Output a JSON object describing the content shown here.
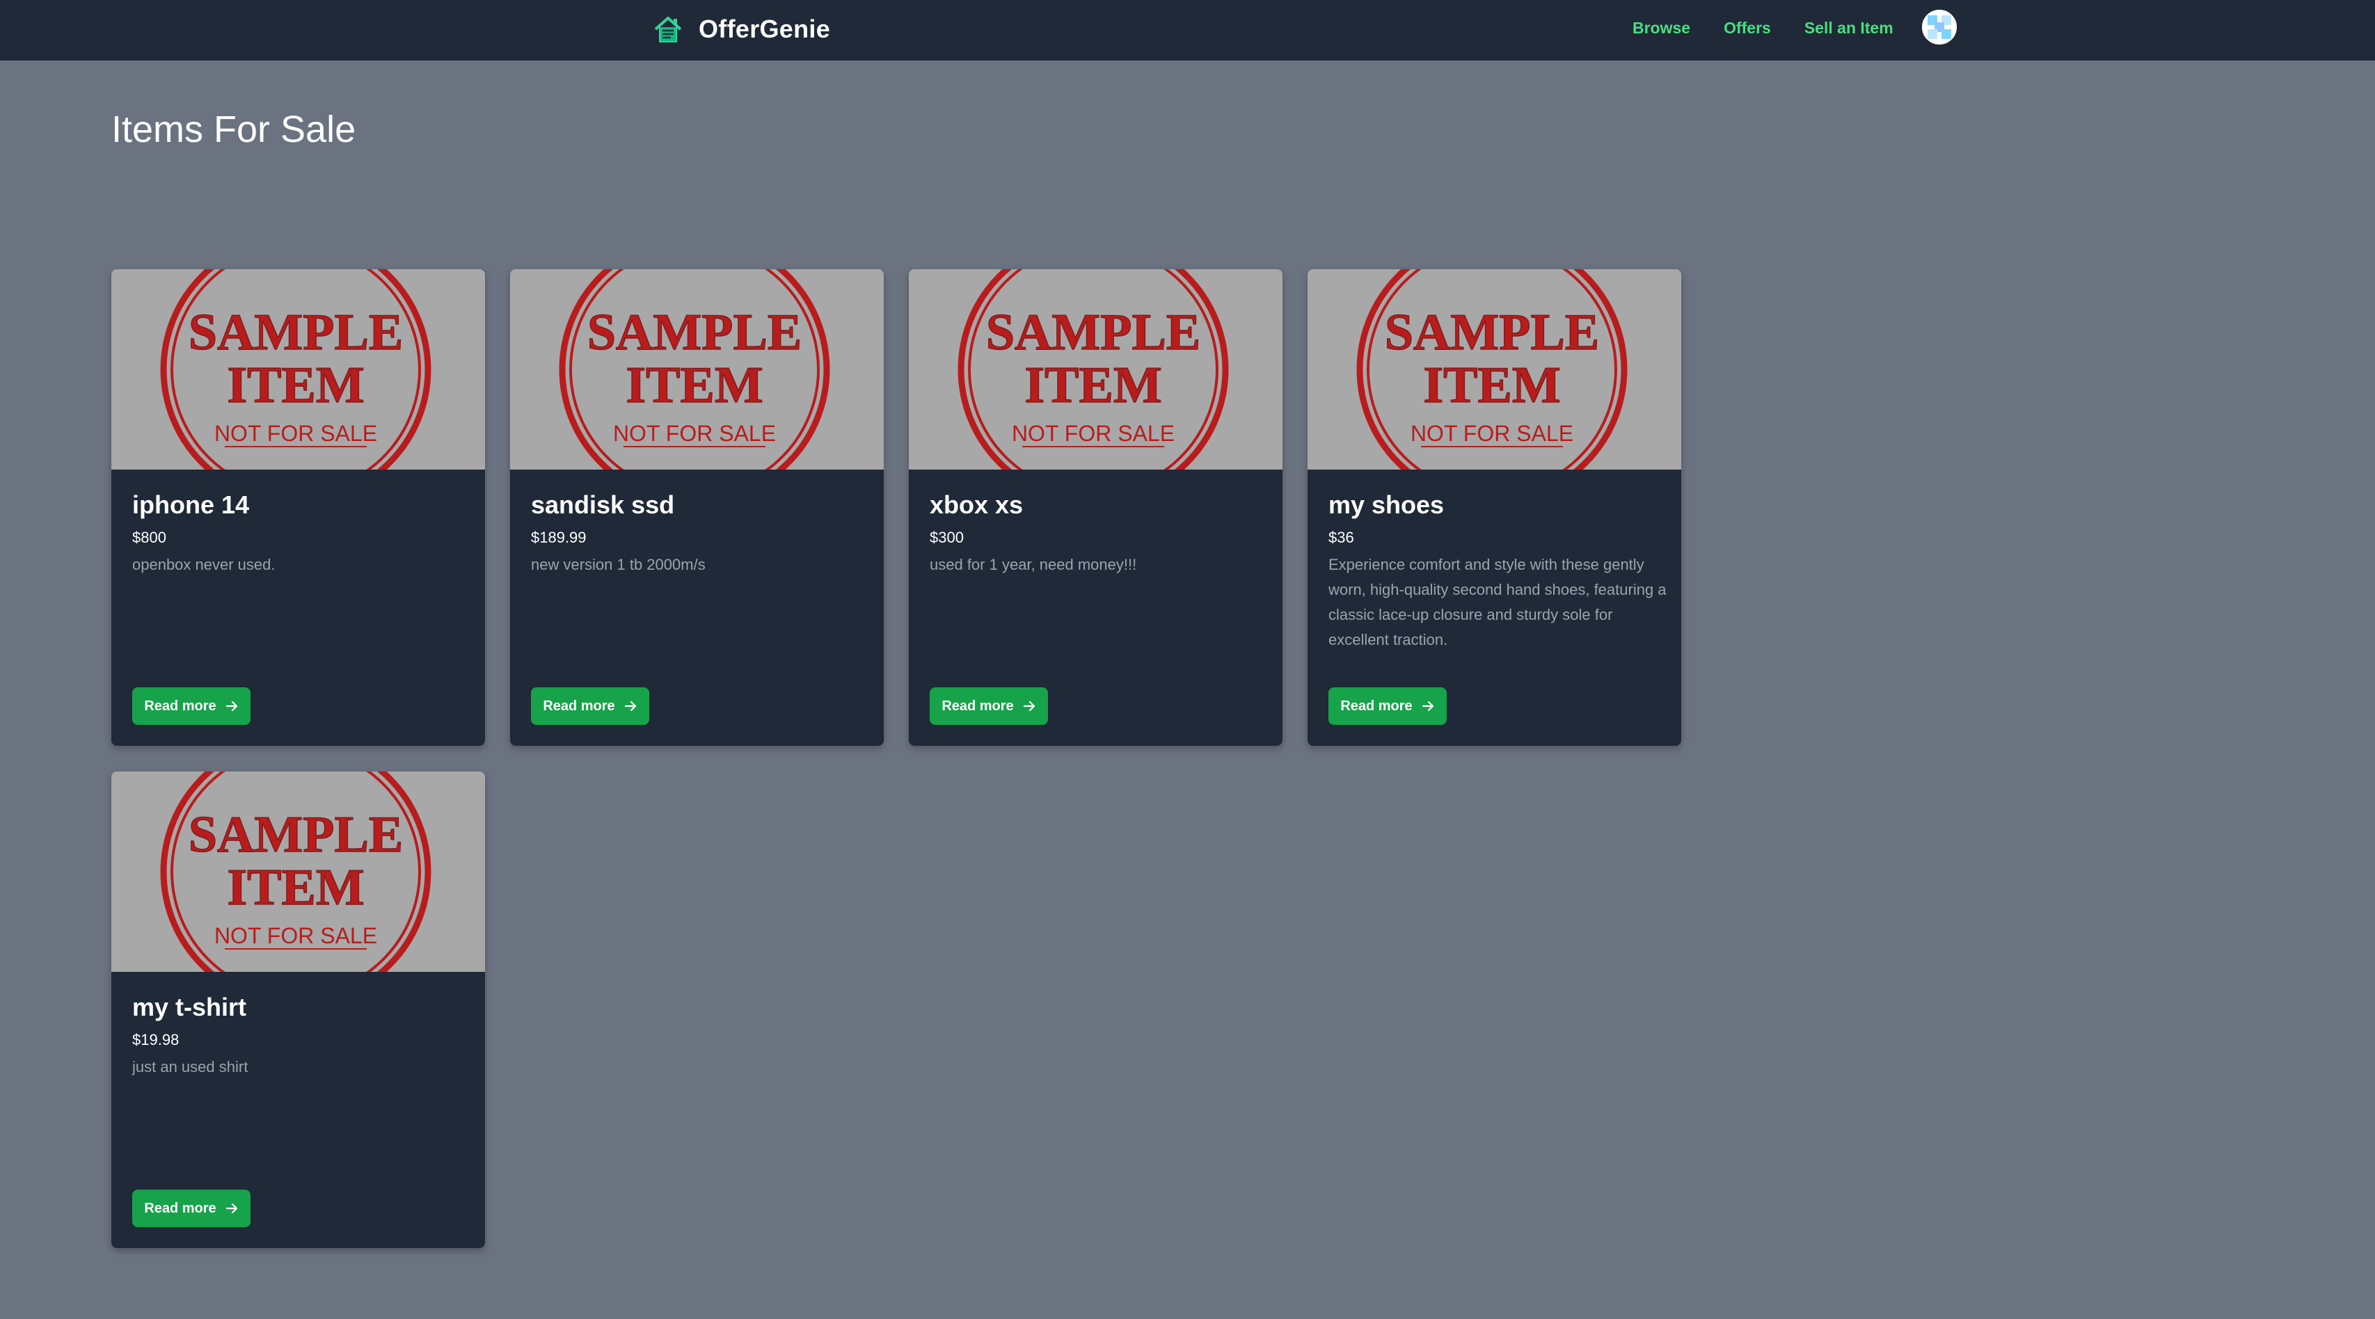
{
  "app": {
    "name": "OfferGenie",
    "accent_color": "#4ade80",
    "button_color": "#16a34a"
  },
  "nav": {
    "links": [
      "Browse",
      "Offers",
      "Sell an Item"
    ]
  },
  "page": {
    "title": "Items For Sale"
  },
  "sample_image": {
    "line1": "SAMPLE",
    "line2": "ITEM",
    "line3": "NOT FOR SALE"
  },
  "items": [
    {
      "title": "iphone 14",
      "price": "$800",
      "description": "openbox never used.",
      "button_label": "Read more"
    },
    {
      "title": "sandisk ssd",
      "price": "$189.99",
      "description": "new version 1 tb 2000m/s",
      "button_label": "Read more"
    },
    {
      "title": "xbox xs",
      "price": "$300",
      "description": "used for 1 year, need money!!!",
      "button_label": "Read more"
    },
    {
      "title": "my shoes",
      "price": "$36",
      "description": "Experience comfort and style with these gently worn, high-quality second hand shoes, featuring a classic lace-up closure and sturdy sole for excellent traction.",
      "button_label": "Read more"
    },
    {
      "title": "my t-shirt",
      "price": "$19.98",
      "description": "just an used shirt",
      "button_label": "Read more"
    }
  ]
}
